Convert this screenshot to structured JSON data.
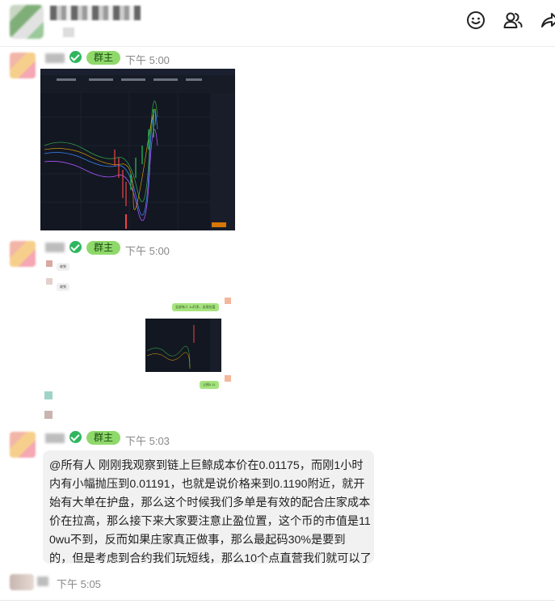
{
  "header": {
    "actions": [
      "emoji-icon",
      "members-icon",
      "share-icon"
    ]
  },
  "role_badge": "群主",
  "messages": [
    {
      "time": "下午 5:00"
    },
    {
      "time": "下午 5:00"
    },
    {
      "time": "下午 5:03",
      "lines": [
        "@所有人 刚刚我观察到链上巨鲸成本价在0.01175，而刚1小时",
        "内有小幅抛压到0.01191，也就是说价格来到0.1190附近，就开",
        "始有大单在护盘，那么这个时候我们多单是有效的配合庄家成本",
        "价在拉高，那么接下来大家要注意止盈位置，这个币的市值是11",
        "0wu不到，反而如果庄家真正做事，那么最起码30%是要到",
        "的，但是考虑到合约我们玩短线，那么10个点直营我们就可以了"
      ]
    },
    {
      "time": "下午 5:05"
    }
  ],
  "forwarded": {
    "bubble_1": "收到",
    "bubble_2": "收到",
    "bubble_3": "全部有人 1u开多，出现拉盘",
    "bubble_4": "止损0.11"
  },
  "colors": {
    "badge_bg": "#8fd96b",
    "verify": "#2fb65f",
    "bubble_bg": "#f1f1f1",
    "chart_bg": "#131722"
  }
}
